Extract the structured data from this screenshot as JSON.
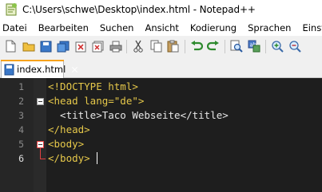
{
  "window": {
    "title": "C:\\Users\\schwe\\Desktop\\index.html - Notepad++"
  },
  "menu": {
    "items": [
      "Datei",
      "Bearbeiten",
      "Suchen",
      "Ansicht",
      "Kodierung",
      "Sprachen",
      "Einstellun"
    ]
  },
  "toolbar": {
    "icons": [
      "new-file-icon",
      "open-file-icon",
      "save-icon",
      "save-all-icon",
      "close-icon",
      "close-all-icon",
      "print-icon",
      "cut-icon",
      "copy-icon",
      "paste-icon",
      "undo-icon",
      "redo-icon",
      "find-icon",
      "replace-icon",
      "zoom-in-icon",
      "zoom-out-icon"
    ]
  },
  "tabs": [
    {
      "label": "index.html",
      "active": true
    }
  ],
  "editor": {
    "lines": [
      {
        "number": "1",
        "text": "<!DOCTYPE html>"
      },
      {
        "number": "2",
        "text": "<head lang=\"de\">"
      },
      {
        "number": "3",
        "text": "  <title>Taco Webseite</title>"
      },
      {
        "number": "4",
        "text": "</head>"
      },
      {
        "number": "5",
        "text": "<body>"
      },
      {
        "number": "6",
        "text": "</body>"
      }
    ],
    "current_line": 6
  },
  "colors": {
    "tag": "#e6c84a",
    "text": "#e6e6e6",
    "background": "#1e1e1e",
    "tab_accent": "#f7a21b"
  }
}
